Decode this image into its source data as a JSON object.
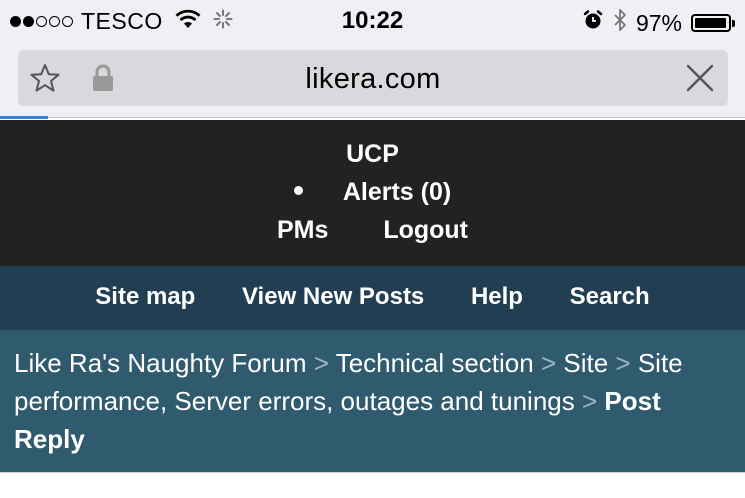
{
  "status_bar": {
    "carrier": "TESCO",
    "time": "10:22",
    "battery_percent": "97%",
    "battery_level": 0.97,
    "signal_bars_filled": 2,
    "signal_bars_total": 5
  },
  "browser": {
    "url": "likera.com"
  },
  "ucp": {
    "title": "UCP",
    "alerts_label": "Alerts (0)",
    "pms_label": "PMs",
    "logout_label": "Logout"
  },
  "nav": {
    "items": [
      "Site map",
      "View New Posts",
      "Help",
      "Search"
    ]
  },
  "breadcrumb": {
    "items": [
      "Like Ra's Naughty Forum",
      "Technical section",
      "Site",
      "Site performance, Server errors, outages and tunings"
    ],
    "separator": ">",
    "current": "Post Reply"
  }
}
